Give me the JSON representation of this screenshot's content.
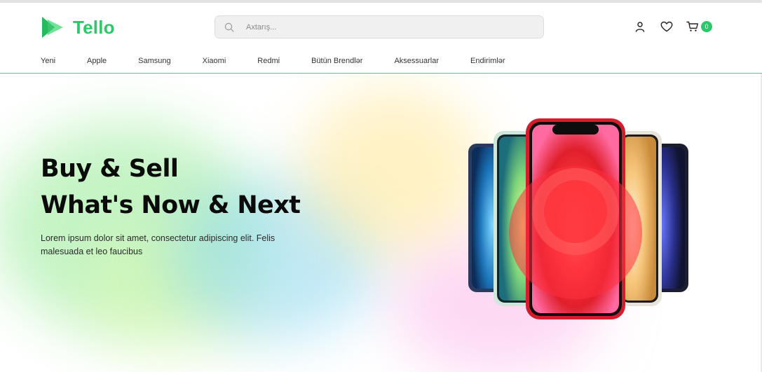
{
  "brand": {
    "name": "Tello",
    "accent": "#2cc96b"
  },
  "search": {
    "placeholder": "Axtarış..."
  },
  "header_icons": {
    "user": "user-icon",
    "wishlist": "heart-icon",
    "cart": "cart-icon",
    "cart_count": "0"
  },
  "nav": {
    "items": [
      {
        "label": "Yeni"
      },
      {
        "label": "Apple"
      },
      {
        "label": "Samsung"
      },
      {
        "label": "Xiaomi"
      },
      {
        "label": "Redmi"
      },
      {
        "label": "Bütün Brendlər"
      },
      {
        "label": "Aksessuarlar"
      },
      {
        "label": "Endirimlər"
      }
    ]
  },
  "hero": {
    "title_line1": "Buy & Sell",
    "title_line2": "What's Now & Next",
    "description": "Lorem ipsum dolor sit amet, consectetur adipiscing elit. Felis malesuada et leo faucibus",
    "image": "iphone-12-lineup-image"
  }
}
